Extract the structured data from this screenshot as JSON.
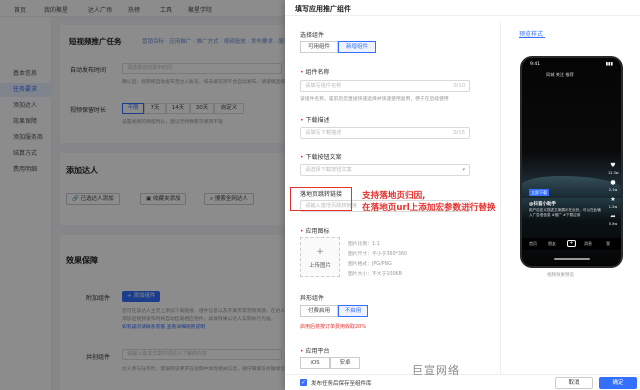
{
  "topnav": {
    "items": [
      "首页",
      "我的聚星",
      "达人广场",
      "热榜",
      "工具",
      "聚星学院"
    ]
  },
  "leftmenu": {
    "items": [
      "基本信息",
      "任务要求",
      "添加达人",
      "效果保障",
      "添加服务商",
      "结算方式",
      "费用明细"
    ],
    "active_index": 1
  },
  "bg": {
    "page_title": "短视频推广任务",
    "substeps": [
      "营销目标 · 应用推广 · 推广方式 · 视频投放 · 发布要求 · 服务达人"
    ],
    "auto_publish_label": "自动发布时间",
    "auto_publish_placeholder": "请选择自动发布时间",
    "auto_publish_hint": "确认后，视频将自动发布至达人账号，如未填写则不会自动发布，请谨慎选择时间",
    "video_keep_label": "视频保留时长",
    "video_keep_options": [
      "不限",
      "7天",
      "14天",
      "30天",
      "自定义"
    ],
    "video_keep_hint": "设置视频的保留时长，建议无特殊要求保持不限",
    "add_kol_title": "添加达人",
    "add_kol_buttons": [
      "已选达人添加",
      "收藏夹添加",
      "搜索全网达人"
    ],
    "effect_title": "效果保障",
    "attach_label": "附加组件",
    "attach_btn": "+ 添加组件",
    "attach_desc": [
      "您可在该达人主页上添加下载链接、组件信息以及开屏页等营销资源，在达人视频中展示并提高转化率。",
      "添加后视频发布时将自动挂载相应组件，具体效果以达人实际执行为准。",
      "如有疑问请联系客服 查看详细规则说明"
    ],
    "share_label": "共创组件",
    "share_placeholder": "请输入需求方案中须达人了解的内容",
    "share_desc": "达人参与任务时，需按照该要求在视频中体现相关信息，请仔细填写并确保信息准确无误。"
  },
  "drawer": {
    "title": "填写应用推广组件",
    "select_label": "选择组件",
    "select_tabs": [
      "可用组件",
      "新增组件"
    ],
    "selected_tab": 1,
    "name_label": "组件名称",
    "name_placeholder": "请填写组件名称",
    "name_count": "0/10",
    "name_hint": "该组件名称，是前后您直接快速选择并快速使用复用，便于在后续使用",
    "dl_desc_label": "下载描述",
    "dl_desc_placeholder": "请填写下载描述",
    "dl_desc_count": "0/15",
    "dl_copy_label": "下载按钮文案",
    "dl_copy_placeholder": "请选择下载按钮文案",
    "landing_label": "落地页跳转链接",
    "landing_placeholder": "请输入落地页跳转链接",
    "callout_lines": [
      "支持落地页归因,",
      "在落地页url上添加宏参数进行替换"
    ],
    "icon_label": "应用图标",
    "upload_label": "上传图片",
    "icon_specs": [
      "图片比例：1:1",
      "图片尺寸：不小于360*360",
      "图片格式：JPG/PNG",
      "图片大小：不大于100KB"
    ],
    "special_label": "异形组件",
    "special_tabs": [
      "付费启用",
      "不启用"
    ],
    "special_selected": 1,
    "special_note": "启用后将按订单费用收取20%",
    "platform_label": "应用平台",
    "platform_tabs": [
      "iOS",
      "安卓"
    ],
    "preview_title": "预览样式",
    "preview_caption": "视频效果预览",
    "footer_check_label": "发布任务后保存至组件库",
    "cancel_label": "取消",
    "ok_label": "确定"
  },
  "phone": {
    "status_time": "9:41",
    "status_right": "▮▮▮",
    "top_nav": "同城  关注  推荐",
    "side_counts": [
      "12.3w",
      "2.1w",
      "1.2w",
      "5.5w"
    ],
    "badge": "立即下载",
    "user": "@抖音小助手",
    "desc": "用户自定义描述文案展示在此处，可以在此输入广告语信息 #推广 #下载应用",
    "bottom_items": [
      "首页",
      "朋友",
      "消息",
      "我"
    ]
  },
  "watermark": "巨宣网络"
}
